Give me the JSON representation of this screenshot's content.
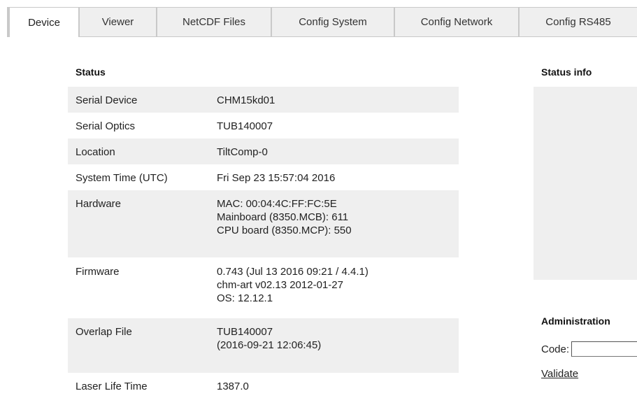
{
  "tabs": [
    {
      "label": "Device",
      "active": true
    },
    {
      "label": "Viewer",
      "active": false
    },
    {
      "label": "NetCDF Files",
      "active": false
    },
    {
      "label": "Config System",
      "active": false
    },
    {
      "label": "Config Network",
      "active": false
    },
    {
      "label": "Config RS485",
      "active": false
    }
  ],
  "status": {
    "title": "Status",
    "rows": [
      {
        "label": "Serial Device",
        "lines": [
          "CHM15kd01"
        ]
      },
      {
        "label": "Serial Optics",
        "lines": [
          "TUB140007"
        ]
      },
      {
        "label": "Location",
        "lines": [
          "TiltComp-0"
        ]
      },
      {
        "label": "System Time (UTC)",
        "lines": [
          "Fri Sep 23 15:57:04 2016"
        ]
      },
      {
        "label": "Hardware",
        "lines": [
          "MAC: 00:04:4C:FF:FC:5E",
          "Mainboard (8350.MCB): 611",
          "CPU board (8350.MCP): 550"
        ]
      },
      {
        "label": "Firmware",
        "lines": [
          "0.743 (Jul 13 2016 09:21 / 4.4.1)",
          "chm-art v02.13 2012-01-27",
          "OS: 12.12.1"
        ]
      },
      {
        "label": "Overlap File",
        "lines": [
          "TUB140007",
          "(2016-09-21 12:06:45)"
        ]
      },
      {
        "label": "Laser Life Time",
        "lines": [
          "1387.0"
        ]
      }
    ]
  },
  "status_info": {
    "title": "Status info"
  },
  "administration": {
    "title": "Administration",
    "code_label": "Code:",
    "code_value": "",
    "validate_label": "Validate"
  },
  "colors": {
    "row_shade": "#efefef",
    "tab_inactive": "#efefef",
    "border": "#c9c9c9"
  }
}
